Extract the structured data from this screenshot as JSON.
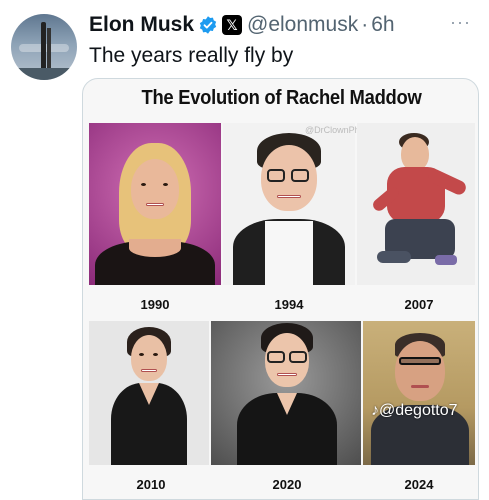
{
  "tweet": {
    "author_name": "Elon Musk",
    "verified_icon": "verified-badge-icon",
    "platform_icon": "x-logo-icon",
    "handle": "@elonmusk",
    "separator": "·",
    "time": "6h",
    "more_icon": "more-options-icon",
    "text": "The years really fly by"
  },
  "media": {
    "title": "The Evolution of Rachel Maddow",
    "watermark": "@DrClownPhD",
    "tiktok_handle": "@degotto7",
    "tiktok_icon": "tiktok-icon",
    "panels": [
      {
        "year": "1990"
      },
      {
        "year": "1994"
      },
      {
        "year": "2007"
      },
      {
        "year": "2010"
      },
      {
        "year": "2020"
      },
      {
        "year": "2024"
      }
    ]
  },
  "colors": {
    "verified_blue": "#1d9bf0",
    "secondary_text": "#536471",
    "border": "#cfd9de"
  }
}
